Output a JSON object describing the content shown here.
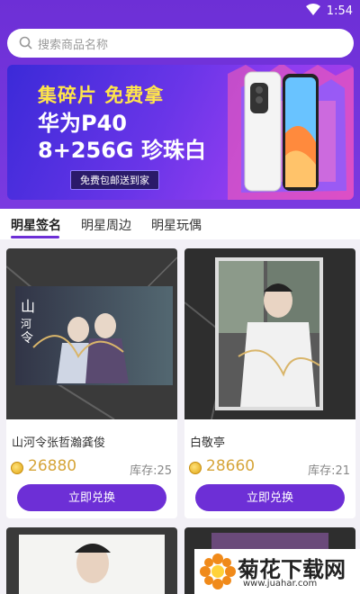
{
  "status": {
    "time": "1:54"
  },
  "search": {
    "placeholder": "搜索商品名称"
  },
  "banner": {
    "line1": "集碎片 免费拿",
    "line2": "华为P40",
    "line3": "8+256G 珍珠白",
    "tagline": "免费包邮送到家"
  },
  "tabs": [
    {
      "label": "明星签名",
      "active": true
    },
    {
      "label": "明星周边",
      "active": false
    },
    {
      "label": "明星玩偶",
      "active": false
    }
  ],
  "products": [
    {
      "name": "山河令张哲瀚龚俊",
      "price": "26880",
      "stock": "库存:25",
      "button": "立即兑换"
    },
    {
      "name": "白敬亭",
      "price": "28660",
      "stock": "库存:21",
      "button": "立即兑换"
    }
  ],
  "watermark": {
    "main": "菊花下载网",
    "url": "www.juahar.com"
  },
  "colors": {
    "primary": "#6d2fd6",
    "price": "#d6a53a"
  }
}
